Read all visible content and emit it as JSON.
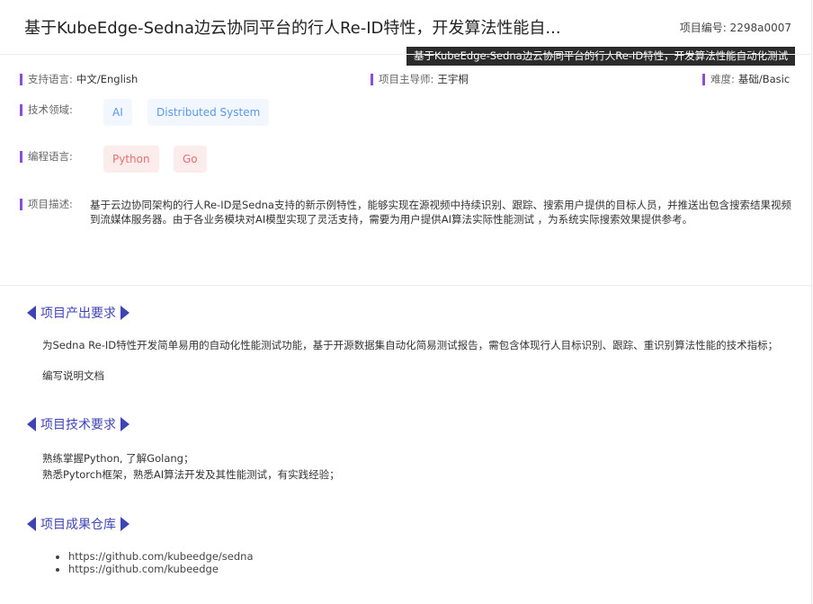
{
  "header": {
    "title": "基于KubeEdge-Sedna边云协同平台的行人Re-ID特性，开发算法性能自...",
    "project_id": "项目编号: 2298a0007",
    "tooltip": "基于KubeEdge-Sedna边云协同平台的行人Re-ID特性，开发算法性能自动化测试"
  },
  "meta": {
    "language_label": "支持语言:",
    "language_value": "中文/English",
    "mentor_label": "项目主导师:",
    "mentor_value": "王宇桐",
    "difficulty_label": "难度:",
    "difficulty_value": "基础/Basic",
    "tech_label": "技术领域:",
    "tech_tags": [
      "AI",
      "Distributed System"
    ],
    "prog_label": "编程语言:",
    "prog_tags": [
      "Python",
      "Go"
    ],
    "desc_label": "项目描述:",
    "desc_text": "基于云边协同架构的行人Re-ID是Sedna支持的新示例特性，能够实现在源视频中持续识别、跟踪、搜索用户提供的目标人员，并推送出包含搜索结果视频到流媒体服务器。由于各业务模块对AI模型实现了灵活支持，需要为用户提供AI算法实际性能测试 ，为系统实际搜索效果提供参考。"
  },
  "sections": {
    "output_title": "项目产出要求",
    "output_lines": [
      "为Sedna Re-ID特性开发简单易用的自动化性能测试功能，基于开源数据集自动化简易测试报告，需包含体现行人目标识别、跟踪、重识别算法性能的技术指标；",
      "编写说明文档"
    ],
    "tech_title": "项目技术要求",
    "tech_lines": [
      "熟练掌握Python, 了解Golang；",
      "熟悉Pytorch框架，熟悉AI算法开发及其性能测试，有实践经验；"
    ],
    "repo_title": "项目成果仓库",
    "repo_links": [
      "https://github.com/kubeedge/sedna",
      "https://github.com/kubeedge"
    ]
  },
  "colors": {
    "accent_bar": "#8a4fd6",
    "section_blue": "#3f44b4",
    "tag_blue_text": "#5a9ae6",
    "tag_red_text": "#e27070"
  }
}
